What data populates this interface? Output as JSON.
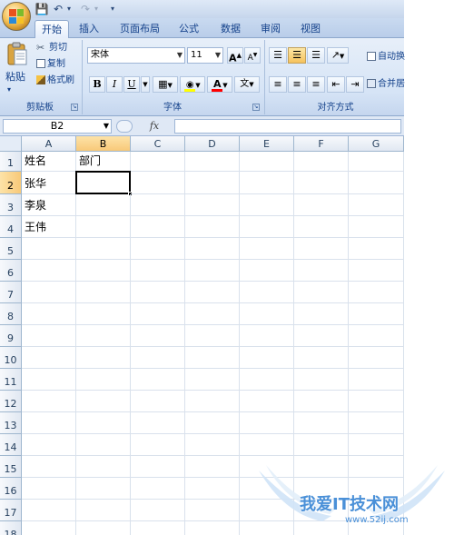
{
  "tabs": [
    "开始",
    "插入",
    "页面布局",
    "公式",
    "数据",
    "审阅",
    "视图"
  ],
  "clipboard": {
    "paste": "粘贴",
    "cut": "剪切",
    "copy": "复制",
    "format_painter": "格式刷",
    "group_label": "剪贴板"
  },
  "font": {
    "name": "宋体",
    "size": "11",
    "grow": "A",
    "shrink": "A",
    "bold": "B",
    "italic": "I",
    "underline": "U",
    "group_label": "字体",
    "font_color": "#ff0000",
    "fill_color": "#ffff00"
  },
  "alignment": {
    "wrap_text": "自动换",
    "merge": "合并居",
    "group_label": "对齐方式"
  },
  "formula_bar": {
    "name_box": "B2",
    "fx": "fx",
    "value": ""
  },
  "columns": [
    "A",
    "B",
    "C",
    "D",
    "E",
    "F",
    "G"
  ],
  "rows": [
    "1",
    "2",
    "3",
    "4",
    "5",
    "6",
    "7",
    "8",
    "9",
    "10",
    "11",
    "12",
    "13",
    "14",
    "15",
    "16",
    "17",
    "18"
  ],
  "cells": {
    "A1": "姓名",
    "B1": "部门",
    "A2": "张华",
    "A3": "李泉",
    "A4": "王伟"
  },
  "selected_cell": "B2",
  "watermark": {
    "text": "我爱IT技术网",
    "url": "www.52ij.com"
  }
}
